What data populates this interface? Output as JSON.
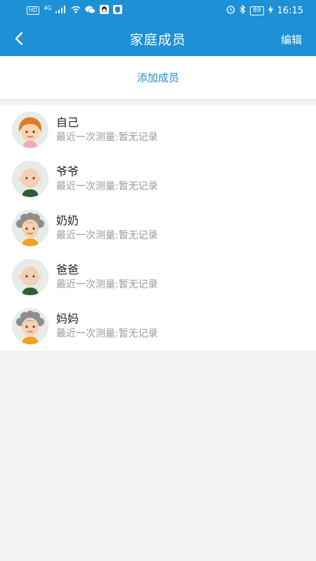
{
  "status_bar": {
    "left_badges": [
      "HD",
      "4G"
    ],
    "battery": "89",
    "time": "16:15",
    "icons": [
      "signal-icon",
      "wifi-icon",
      "wechat-icon",
      "qq-icon",
      "shield-icon",
      "alarm-icon",
      "bluetooth-icon",
      "charging-icon"
    ]
  },
  "navbar": {
    "title": "家庭成员",
    "edit_label": "编辑",
    "back_icon": "chevron-left-icon",
    "background": "#1e90d6"
  },
  "add_member": {
    "label": "添加成员",
    "color": "#1e8fd0"
  },
  "members": [
    {
      "name": "自己",
      "status": "最近一次测量:暂无记录",
      "avatar": "woman-avatar-icon"
    },
    {
      "name": "爷爷",
      "status": "最近一次测量:暂无记录",
      "avatar": "grandpa-avatar-icon"
    },
    {
      "name": "奶奶",
      "status": "最近一次测量:暂无记录",
      "avatar": "grandma-avatar-icon"
    },
    {
      "name": "爸爸",
      "status": "最近一次测量:暂无记录",
      "avatar": "grandpa-avatar-icon"
    },
    {
      "name": "妈妈",
      "status": "最近一次测量:暂无记录",
      "avatar": "grandma-avatar-icon"
    }
  ]
}
